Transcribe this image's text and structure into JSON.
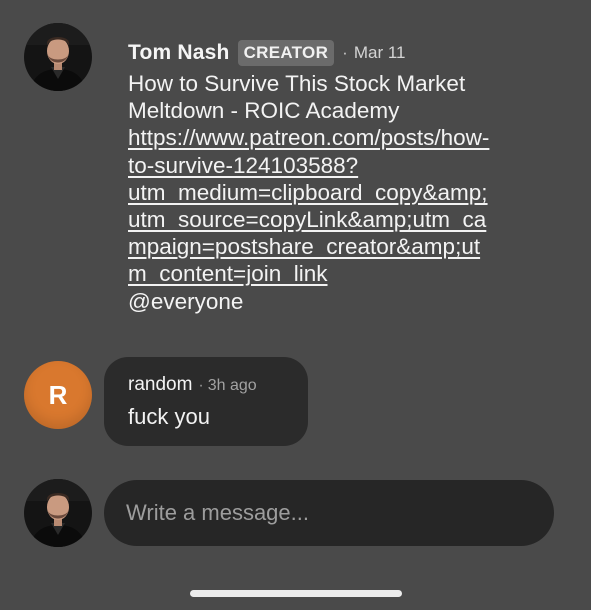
{
  "post": {
    "author": "Tom Nash",
    "badge": "CREATOR",
    "separator": "·",
    "date": "Mar 11",
    "title_lines": [
      "How to Survive This Stock Market",
      "Meltdown - ROIC Academy"
    ],
    "link_lines": [
      "https://www.patreon.com/posts/how-",
      "to-survive-124103588?",
      "utm_medium=clipboard_copy&amp;",
      "utm_source=copyLink&amp;utm_ca",
      "mpaign=postshare_creator&amp;ut",
      "m_content=join_link"
    ],
    "mention": "@everyone",
    "avatar_icon": "profile-photo"
  },
  "reply": {
    "avatar_initial": "R",
    "avatar_color": "#d9782e",
    "author": "random",
    "separator": "·",
    "time": "3h ago",
    "text": "fuck you"
  },
  "composer": {
    "placeholder": "Write a message...",
    "avatar_icon": "profile-photo"
  },
  "colors": {
    "background": "#4a4a4a",
    "bubble": "#2b2b2b",
    "input": "#262626",
    "badge": "#6b6b6b"
  }
}
